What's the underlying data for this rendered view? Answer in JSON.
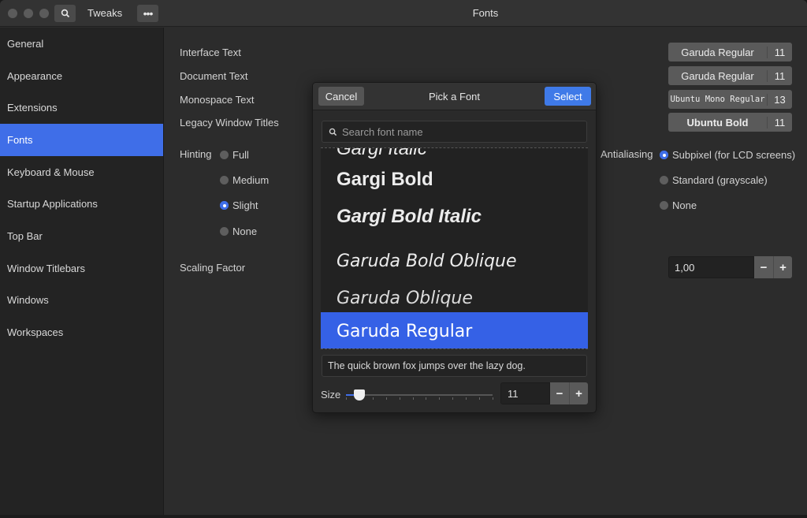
{
  "app": {
    "name": "Tweaks",
    "page_title": "Fonts"
  },
  "sidebar": {
    "items": [
      {
        "label": "General"
      },
      {
        "label": "Appearance"
      },
      {
        "label": "Extensions"
      },
      {
        "label": "Fonts",
        "active": true
      },
      {
        "label": "Keyboard & Mouse"
      },
      {
        "label": "Startup Applications"
      },
      {
        "label": "Top Bar"
      },
      {
        "label": "Window Titlebars"
      },
      {
        "label": "Windows"
      },
      {
        "label": "Workspaces"
      }
    ]
  },
  "fonts": {
    "interface": {
      "label": "Interface Text",
      "font": "Garuda Regular",
      "size": "11"
    },
    "document": {
      "label": "Document Text",
      "font": "Garuda Regular",
      "size": "11"
    },
    "monospace": {
      "label": "Monospace Text",
      "font": "Ubuntu Mono Regular",
      "size": "13"
    },
    "legacy": {
      "label": "Legacy Window Titles",
      "font": "Ubuntu Bold",
      "size": "11"
    }
  },
  "hinting": {
    "label": "Hinting",
    "options": [
      "Full",
      "Medium",
      "Slight",
      "None"
    ],
    "selected": "Slight"
  },
  "antialiasing": {
    "label": "Antialiasing",
    "options": [
      "Subpixel (for LCD screens)",
      "Standard (grayscale)",
      "None"
    ],
    "selected": "Subpixel (for LCD screens)"
  },
  "scaling": {
    "label": "Scaling Factor",
    "value": "1,00",
    "minus": "−",
    "plus": "+"
  },
  "dialog": {
    "title": "Pick a Font",
    "cancel": "Cancel",
    "select": "Select",
    "search_placeholder": "Search font name",
    "list": [
      {
        "name": "Gargi Italic",
        "style": "italic"
      },
      {
        "name": "Gargi Bold",
        "style": "bold"
      },
      {
        "name": "Gargi Bold Italic",
        "style": "bold-italic"
      },
      {
        "name": "Garuda Bold Oblique",
        "style": "bold-italic"
      },
      {
        "name": "Garuda Oblique",
        "style": "italic"
      },
      {
        "name": "Garuda Regular",
        "style": "regular",
        "selected": true
      }
    ],
    "preview_text": "The quick brown fox jumps over the lazy dog.",
    "size_label": "Size",
    "size_value": "11",
    "size_slider_fraction": 0.09,
    "minus": "−",
    "plus": "+"
  },
  "colors": {
    "accent": "#3f6ee8",
    "select_button": "#3f7ae8"
  },
  "icons": {
    "search": "search-icon",
    "menu": "more-icon"
  }
}
